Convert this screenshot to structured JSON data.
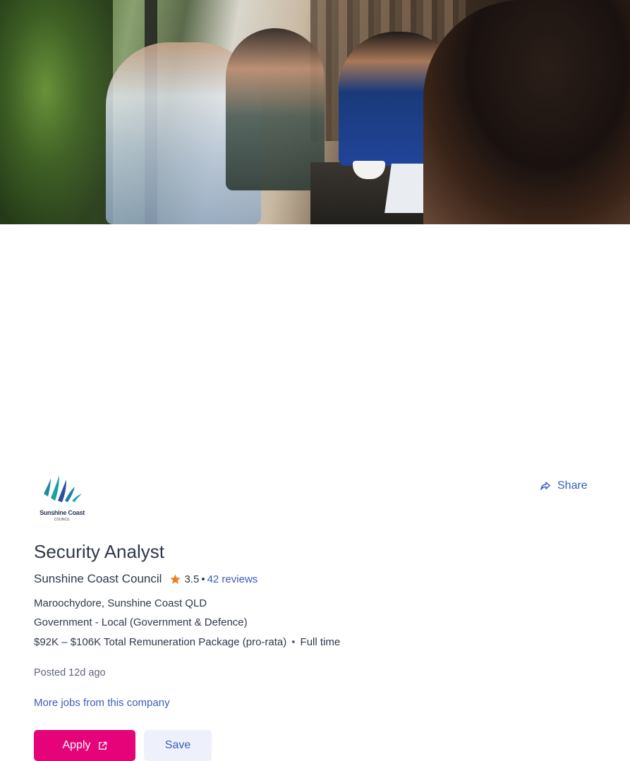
{
  "hero": {
    "image_alt": "people-meeting-at-cafe-table-photo"
  },
  "company_logo": {
    "name": "Sunshine Coast",
    "sub": "COUNCIL"
  },
  "actions": {
    "share_label": "Share",
    "apply_label": "Apply",
    "save_label": "Save"
  },
  "job": {
    "title": "Security Analyst",
    "company": "Sunshine Coast Council",
    "rating": "3.5",
    "rating_sep": "•",
    "reviews": "42 reviews",
    "location": "Maroochydore, Sunshine Coast QLD",
    "category": "Government - Local (Government & Defence)",
    "salary": "$92K – $106K Total Remuneration Package (pro-rata)",
    "meta_sep": "•",
    "work_type": "Full time",
    "posted": "Posted 12d ago",
    "more_jobs": "More jobs from this company"
  },
  "colors": {
    "accent": "#e60278",
    "link": "#3a5dbb",
    "star": "#f07f1a",
    "text": "#2e3849"
  },
  "icons": [
    "share-icon",
    "star-icon",
    "external-link-icon"
  ]
}
